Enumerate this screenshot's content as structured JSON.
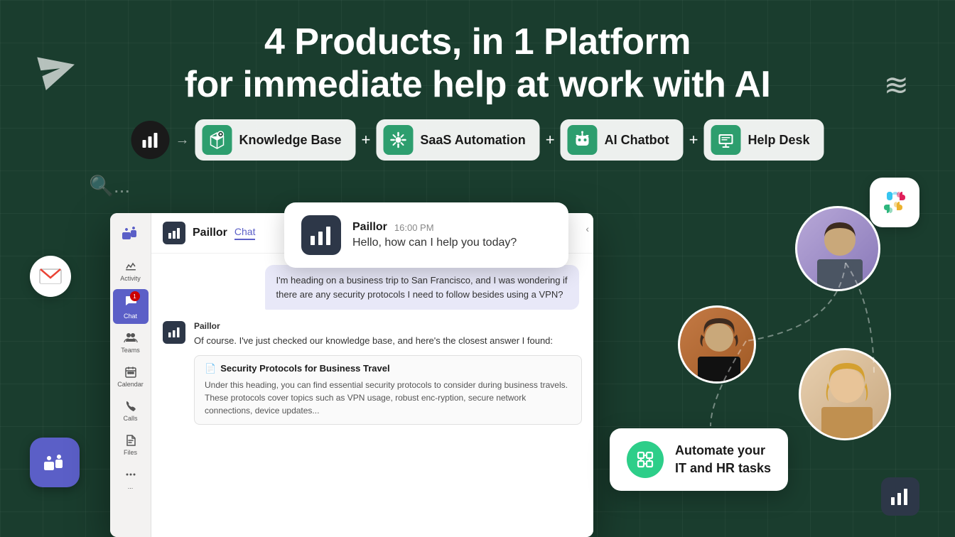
{
  "header": {
    "line1": "4 Products, in 1 Platform",
    "line2": "for immediate help at work with AI"
  },
  "products": [
    {
      "id": "kb",
      "label": "Knowledge Base",
      "iconType": "house"
    },
    {
      "id": "saas",
      "label": "SaaS Automation",
      "iconType": "gear"
    },
    {
      "id": "chatbot",
      "label": "AI Chatbot",
      "iconType": "robot"
    },
    {
      "id": "helpdesk",
      "label": "Help Desk",
      "iconType": "screen"
    }
  ],
  "teams": {
    "sidebar": {
      "items": [
        {
          "label": "Activity",
          "icon": "bell"
        },
        {
          "label": "Chat",
          "icon": "chat",
          "active": true,
          "badge": "1"
        },
        {
          "label": "Teams",
          "icon": "people"
        },
        {
          "label": "Calendar",
          "icon": "calendar"
        },
        {
          "label": "Calls",
          "icon": "phone"
        },
        {
          "label": "Files",
          "icon": "file"
        },
        {
          "label": "...",
          "icon": "dots"
        }
      ]
    },
    "chat": {
      "bot_name": "Paillor",
      "tab_label": "Chat",
      "messages": [
        {
          "type": "user",
          "text": "I'm heading on a business trip to San Francisco, and I was wondering if there are any security protocols I need to follow besides using a VPN?"
        },
        {
          "type": "bot",
          "sender": "Paillor",
          "text": "Of course. I've just checked our knowledge base, and here's the closest answer I found:",
          "card": {
            "title": "Security Protocols for Business Travel",
            "text": "Under this heading, you can find essential security protocols to consider during business travels. These protocols cover topics such as VPN usage, robust enc-ryption, secure network connections, device updates..."
          }
        }
      ]
    }
  },
  "bubble": {
    "sender": "Paillor",
    "time": "16:00 PM",
    "text": "Hello, how can I help you today?"
  },
  "automate_card": {
    "text": "Automate your\nIT and HR tasks"
  },
  "icons": {
    "slack": "Slack",
    "gmail": "Gmail",
    "teams": "Teams",
    "paillor": "Paillor"
  }
}
